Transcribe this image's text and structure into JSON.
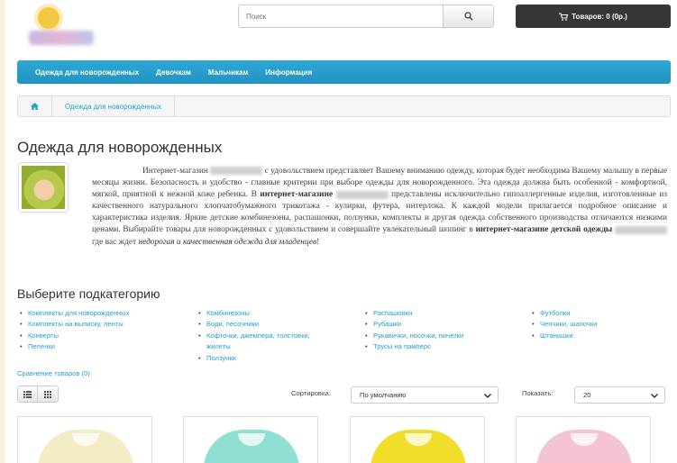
{
  "search": {
    "placeholder": "Поиск"
  },
  "cart": {
    "label": "Товаров: 0 (0р.)"
  },
  "nav": {
    "items": [
      "Одежда для новорожденных",
      "Девочкам",
      "Мальчикам",
      "Информация"
    ]
  },
  "breadcrumb": {
    "current": "Одежда для новорожденных"
  },
  "page": {
    "title": "Одежда для новорожденных"
  },
  "description": {
    "p1a": "Интернет-магазин",
    "p1b": "с удовольствием представляет Вашему вниманию одежду, которая будет необходима Вашему малышу в первые месяцы жизни. Безопасность и удобство - главные критерии при выборе одежды для новорожденного. Эта одежда должна быть особенной - комфортной, мягкой, приятной к нежной коже ребенка. В",
    "p1bold": "интернет-магазине",
    "p1c": "представлены исключительно гипоаллергенные изделия, изготовленные из качественного натурального хлопчатобумажного трикотажа - кулирки, футера, интерлока. К каждой модели прилагается подробное описание и характеристика изделия. Яркие детские комбинезоны, распашонки, ползунки, комплекты и другая одежда собственного производства отличаются низкими ценами. Выбирайте товары для новорожденных с удовольствием и совершайте увлекательный шопинг в",
    "p1bold2": "интернет-магазине детской одежды",
    "p1d": "где вас ждет",
    "p1italic": "недорогая и качественная одежда для младенцев",
    "p1end": "!"
  },
  "subcategories": {
    "title": "Выберите подкатегорию",
    "col1": [
      "Комплекты для новорожденных",
      "Комплекты на выписку, ленты",
      "Конверты",
      "Пеленки"
    ],
    "col2": [
      "Комбинезоны",
      "Боди, песочники",
      "Кофточки, джемпера, толстовки, жилеты",
      "Ползунки"
    ],
    "col3": [
      "Распашонки",
      "Рубашки",
      "Рукавички, носочки, пинетки",
      "Трусы на памперс"
    ],
    "col4": [
      "Футболки",
      "Чепчики, шапочки",
      "Штанишки"
    ]
  },
  "compare": {
    "label": "Сравнение товаров (0)"
  },
  "sort": {
    "label": "Сортировка:",
    "value": "По умолчанию"
  },
  "limit": {
    "label": "Показать:",
    "value": "20"
  },
  "colors": {
    "nav": "#2292c2",
    "link": "#23a1d1",
    "cart": "#363636",
    "products": [
      "#f4ecc4",
      "#8fe0d2",
      "#f1de2a",
      "#f3c4d4"
    ]
  }
}
